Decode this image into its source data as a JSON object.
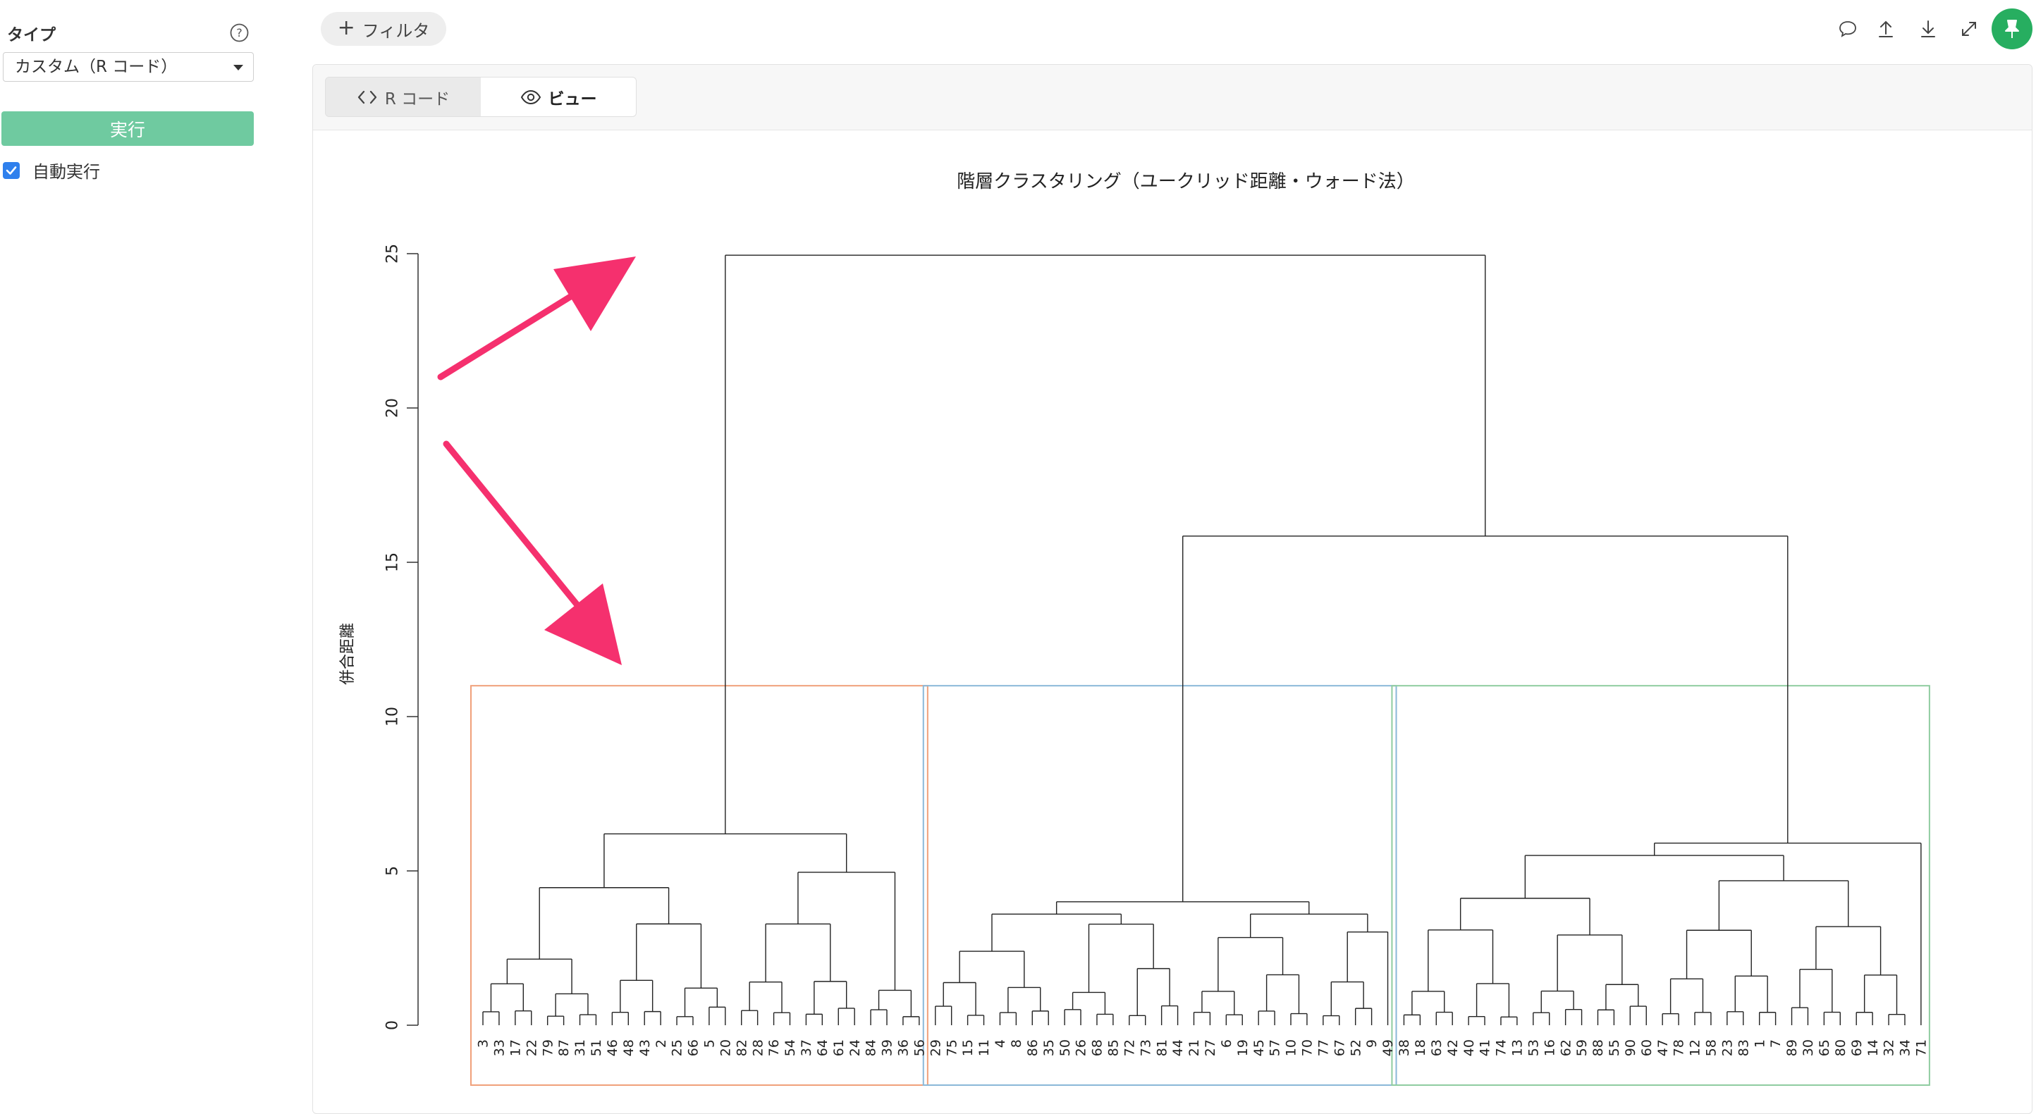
{
  "sidebar": {
    "type_label": "タイプ",
    "type_select": "カスタム（R コード）",
    "run_label": "実行",
    "auto_run_label": "自動実行",
    "auto_run_checked": true
  },
  "toolbar": {
    "filter_label": "フィルタ",
    "icons": [
      "comment-icon",
      "upload-icon",
      "download-icon",
      "expand-icon",
      "pin-icon"
    ]
  },
  "tabs": [
    {
      "label": "R コード",
      "icon": "code-icon",
      "active": false
    },
    {
      "label": "ビュー",
      "icon": "eye-icon",
      "active": true
    }
  ],
  "colors": {
    "accent_green": "#6fcaa0",
    "pin_green": "#27ae60",
    "arrow_pink": "#f5306e",
    "cluster_1": "#f0a07a",
    "cluster_2": "#8ab8d8",
    "cluster_3": "#8fcca0"
  },
  "chart_data": {
    "type": "dendrogram",
    "title": "階層クラスタリング（ユークリッド距離・ウォード法）",
    "ylabel": "併合距離",
    "xlabel": "",
    "ylim": [
      0,
      25
    ],
    "yticks": [
      0,
      5,
      10,
      15,
      20,
      25
    ],
    "grid": false,
    "leaves": [
      3,
      33,
      17,
      22,
      79,
      87,
      31,
      51,
      46,
      48,
      43,
      2,
      25,
      66,
      5,
      20,
      82,
      28,
      76,
      54,
      37,
      64,
      61,
      24,
      84,
      39,
      36,
      56,
      29,
      75,
      15,
      11,
      4,
      8,
      86,
      35,
      50,
      26,
      68,
      85,
      72,
      73,
      81,
      44,
      21,
      27,
      6,
      19,
      45,
      57,
      10,
      70,
      77,
      67,
      52,
      9,
      49,
      38,
      18,
      63,
      42,
      40,
      41,
      74,
      13,
      53,
      16,
      62,
      59,
      88,
      55,
      90,
      60,
      47,
      78,
      12,
      58,
      23,
      83,
      1,
      7,
      89,
      30,
      65,
      80,
      69,
      14,
      32,
      34,
      71
    ],
    "merge_heights": {
      "root": 24.95,
      "right_group": 15.85,
      "cluster_1": 6.2,
      "cluster_2": 4.0,
      "cluster_3": 5.9
    },
    "clusters": [
      {
        "leaf_start": 0,
        "leaf_end": 27,
        "color": "#f0a07a"
      },
      {
        "leaf_start": 28,
        "leaf_end": 56,
        "color": "#8ab8d8"
      },
      {
        "leaf_start": 57,
        "leaf_end": 89,
        "color": "#8fcca0"
      }
    ],
    "cut_height": 11.0
  }
}
